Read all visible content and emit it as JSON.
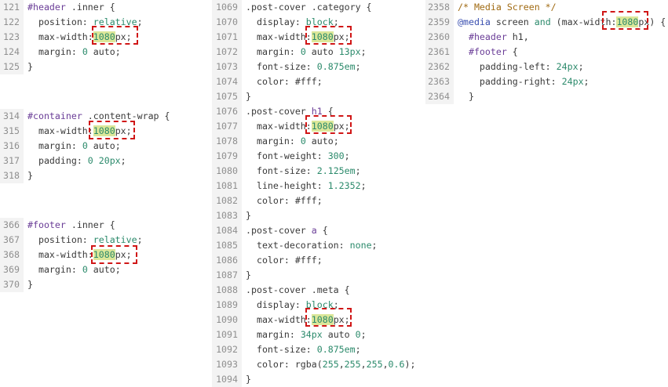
{
  "panels": [
    {
      "id": "p1",
      "lines": [
        {
          "n": "121",
          "segs": [
            {
              "t": "#header",
              "c": "sel"
            },
            {
              "t": " .inner {",
              "c": ""
            }
          ]
        },
        {
          "n": "122",
          "segs": [
            {
              "t": "  position: ",
              "c": "prop"
            },
            {
              "t": "relative",
              "c": "kw"
            },
            {
              "t": ";",
              "c": ""
            }
          ]
        },
        {
          "n": "123",
          "segs": [
            {
              "t": "  max-width:",
              "c": "prop"
            },
            {
              "t": "1080",
              "c": "num hl"
            },
            {
              "t": "px;",
              "c": ""
            }
          ]
        },
        {
          "n": "124",
          "segs": [
            {
              "t": "  margin: ",
              "c": "prop"
            },
            {
              "t": "0",
              "c": "num"
            },
            {
              "t": " auto;",
              "c": ""
            }
          ]
        },
        {
          "n": "125",
          "segs": [
            {
              "t": "}",
              "c": ""
            }
          ]
        }
      ]
    },
    {
      "id": "p2",
      "lines": [
        {
          "n": "314",
          "segs": [
            {
              "t": "#container",
              "c": "sel"
            },
            {
              "t": " .content-wrap {",
              "c": ""
            }
          ]
        },
        {
          "n": "315",
          "segs": [
            {
              "t": "  max-width:",
              "c": "prop"
            },
            {
              "t": "1080",
              "c": "num hl"
            },
            {
              "t": "px;",
              "c": ""
            }
          ]
        },
        {
          "n": "316",
          "segs": [
            {
              "t": "  margin: ",
              "c": "prop"
            },
            {
              "t": "0",
              "c": "num"
            },
            {
              "t": " auto;",
              "c": ""
            }
          ]
        },
        {
          "n": "317",
          "segs": [
            {
              "t": "  padding: ",
              "c": "prop"
            },
            {
              "t": "0 20px",
              "c": "num"
            },
            {
              "t": ";",
              "c": ""
            }
          ]
        },
        {
          "n": "318",
          "segs": [
            {
              "t": "}",
              "c": ""
            }
          ]
        }
      ]
    },
    {
      "id": "p3",
      "lines": [
        {
          "n": "366",
          "segs": [
            {
              "t": "#footer",
              "c": "sel"
            },
            {
              "t": " .inner {",
              "c": ""
            }
          ]
        },
        {
          "n": "367",
          "segs": [
            {
              "t": "  position: ",
              "c": "prop"
            },
            {
              "t": "relative",
              "c": "kw"
            },
            {
              "t": ";",
              "c": ""
            }
          ]
        },
        {
          "n": "368",
          "segs": [
            {
              "t": "  max-width:",
              "c": "prop"
            },
            {
              "t": "1080",
              "c": "num hl"
            },
            {
              "t": "px;",
              "c": ""
            }
          ]
        },
        {
          "n": "369",
          "segs": [
            {
              "t": "  margin: ",
              "c": "prop"
            },
            {
              "t": "0",
              "c": "num"
            },
            {
              "t": " auto;",
              "c": ""
            }
          ]
        },
        {
          "n": "370",
          "segs": [
            {
              "t": "}",
              "c": ""
            }
          ]
        }
      ]
    },
    {
      "id": "p4",
      "lines": [
        {
          "n": "1069",
          "segs": [
            {
              "t": ".post-cover .category {",
              "c": ""
            }
          ]
        },
        {
          "n": "1070",
          "segs": [
            {
              "t": "  display: ",
              "c": "prop"
            },
            {
              "t": "block",
              "c": "kw"
            },
            {
              "t": ";",
              "c": ""
            }
          ]
        },
        {
          "n": "1071",
          "segs": [
            {
              "t": "  max-width:",
              "c": "prop"
            },
            {
              "t": "1080",
              "c": "num hl"
            },
            {
              "t": "px;",
              "c": ""
            }
          ]
        },
        {
          "n": "1072",
          "segs": [
            {
              "t": "  margin: ",
              "c": "prop"
            },
            {
              "t": "0",
              "c": "num"
            },
            {
              "t": " auto ",
              "c": ""
            },
            {
              "t": "13px",
              "c": "num"
            },
            {
              "t": ";",
              "c": ""
            }
          ]
        },
        {
          "n": "1073",
          "segs": [
            {
              "t": "  font-size: ",
              "c": "prop"
            },
            {
              "t": "0.875em",
              "c": "num"
            },
            {
              "t": ";",
              "c": ""
            }
          ]
        },
        {
          "n": "1074",
          "segs": [
            {
              "t": "  color: ",
              "c": "prop"
            },
            {
              "t": "#fff",
              "c": ""
            },
            {
              "t": ";",
              "c": ""
            }
          ]
        },
        {
          "n": "1075",
          "segs": [
            {
              "t": "}",
              "c": ""
            }
          ]
        },
        {
          "n": "1076",
          "segs": [
            {
              "t": ".post-cover ",
              "c": ""
            },
            {
              "t": "h1",
              "c": "sel"
            },
            {
              "t": " {",
              "c": ""
            }
          ]
        },
        {
          "n": "1077",
          "segs": [
            {
              "t": "  max-width:",
              "c": "prop"
            },
            {
              "t": "1080",
              "c": "num hl"
            },
            {
              "t": "px;",
              "c": ""
            }
          ]
        },
        {
          "n": "1078",
          "segs": [
            {
              "t": "  margin: ",
              "c": "prop"
            },
            {
              "t": "0",
              "c": "num"
            },
            {
              "t": " auto;",
              "c": ""
            }
          ]
        },
        {
          "n": "1079",
          "segs": [
            {
              "t": "  font-weight: ",
              "c": "prop"
            },
            {
              "t": "300",
              "c": "num"
            },
            {
              "t": ";",
              "c": ""
            }
          ]
        },
        {
          "n": "1080",
          "segs": [
            {
              "t": "  font-size: ",
              "c": "prop"
            },
            {
              "t": "2.125em",
              "c": "num"
            },
            {
              "t": ";",
              "c": ""
            }
          ]
        },
        {
          "n": "1081",
          "segs": [
            {
              "t": "  line-height: ",
              "c": "prop"
            },
            {
              "t": "1.2352",
              "c": "num"
            },
            {
              "t": ";",
              "c": ""
            }
          ]
        },
        {
          "n": "1082",
          "segs": [
            {
              "t": "  color: ",
              "c": "prop"
            },
            {
              "t": "#fff",
              "c": ""
            },
            {
              "t": ";",
              "c": ""
            }
          ]
        },
        {
          "n": "1083",
          "segs": [
            {
              "t": "}",
              "c": ""
            }
          ]
        },
        {
          "n": "1084",
          "segs": [
            {
              "t": ".post-cover ",
              "c": ""
            },
            {
              "t": "a",
              "c": "sel"
            },
            {
              "t": " {",
              "c": ""
            }
          ]
        },
        {
          "n": "1085",
          "segs": [
            {
              "t": "  text-decoration: ",
              "c": "prop"
            },
            {
              "t": "none",
              "c": "kw"
            },
            {
              "t": ";",
              "c": ""
            }
          ]
        },
        {
          "n": "1086",
          "segs": [
            {
              "t": "  color: ",
              "c": "prop"
            },
            {
              "t": "#fff",
              "c": ""
            },
            {
              "t": ";",
              "c": ""
            }
          ]
        },
        {
          "n": "1087",
          "segs": [
            {
              "t": "}",
              "c": ""
            }
          ]
        },
        {
          "n": "1088",
          "segs": [
            {
              "t": ".post-cover .meta {",
              "c": ""
            }
          ]
        },
        {
          "n": "1089",
          "segs": [
            {
              "t": "  display: ",
              "c": "prop"
            },
            {
              "t": "block",
              "c": "kw"
            },
            {
              "t": ";",
              "c": ""
            }
          ]
        },
        {
          "n": "1090",
          "segs": [
            {
              "t": "  max-width:",
              "c": "prop"
            },
            {
              "t": "1080",
              "c": "num hl"
            },
            {
              "t": "px;",
              "c": ""
            }
          ]
        },
        {
          "n": "1091",
          "segs": [
            {
              "t": "  margin: ",
              "c": "prop"
            },
            {
              "t": "34px",
              "c": "num"
            },
            {
              "t": " auto ",
              "c": ""
            },
            {
              "t": "0",
              "c": "num"
            },
            {
              "t": ";",
              "c": ""
            }
          ]
        },
        {
          "n": "1092",
          "segs": [
            {
              "t": "  font-size: ",
              "c": "prop"
            },
            {
              "t": "0.875em",
              "c": "num"
            },
            {
              "t": ";",
              "c": ""
            }
          ]
        },
        {
          "n": "1093",
          "segs": [
            {
              "t": "  color: ",
              "c": "prop"
            },
            {
              "t": "rgba(",
              "c": ""
            },
            {
              "t": "255",
              "c": "num"
            },
            {
              "t": ",",
              "c": ""
            },
            {
              "t": "255",
              "c": "num"
            },
            {
              "t": ",",
              "c": ""
            },
            {
              "t": "255",
              "c": "num"
            },
            {
              "t": ",",
              "c": ""
            },
            {
              "t": "0.6",
              "c": "num"
            },
            {
              "t": ");",
              "c": ""
            }
          ]
        },
        {
          "n": "1094",
          "segs": [
            {
              "t": "}",
              "c": ""
            }
          ]
        }
      ]
    },
    {
      "id": "p5",
      "lines": [
        {
          "n": "2358",
          "segs": [
            {
              "t": "/* Media Screen */",
              "c": "cmt"
            }
          ]
        },
        {
          "n": "2359",
          "segs": [
            {
              "t": "@media",
              "c": "at"
            },
            {
              "t": " screen ",
              "c": ""
            },
            {
              "t": "and",
              "c": "kw"
            },
            {
              "t": " (max-width:",
              "c": ""
            },
            {
              "t": "1080",
              "c": "num hl"
            },
            {
              "t": "px) {",
              "c": ""
            }
          ]
        },
        {
          "n": "2360",
          "segs": [
            {
              "t": "  #header",
              "c": "sel"
            },
            {
              "t": " h1,",
              "c": ""
            }
          ]
        },
        {
          "n": "2361",
          "segs": [
            {
              "t": "  #footer",
              "c": "sel"
            },
            {
              "t": " {",
              "c": ""
            }
          ]
        },
        {
          "n": "2362",
          "segs": [
            {
              "t": "    padding-left: ",
              "c": "prop"
            },
            {
              "t": "24px",
              "c": "num"
            },
            {
              "t": ";",
              "c": ""
            }
          ]
        },
        {
          "n": "2363",
          "segs": [
            {
              "t": "    padding-right: ",
              "c": "prop"
            },
            {
              "t": "24px",
              "c": "num"
            },
            {
              "t": ";",
              "c": ""
            }
          ]
        },
        {
          "n": "2364",
          "segs": [
            {
              "t": "  }",
              "c": ""
            }
          ]
        }
      ]
    }
  ]
}
